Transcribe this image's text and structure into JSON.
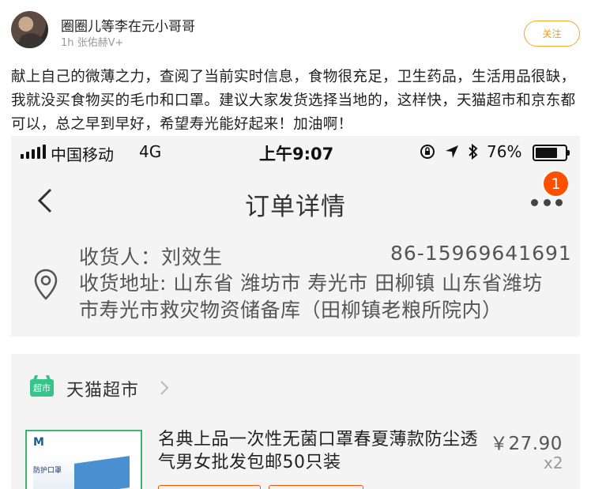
{
  "post": {
    "username": "圈圈儿等李在元小哥哥",
    "meta": "1h 张佑赫V+",
    "follow_label": "关注",
    "text": "献上自己的微薄之力，查阅了当前实时信息，食物很充足，卫生药品，生活用品很缺，我就没买食物买的毛巾和口罩。建议大家发货选择当地的，这样快，天猫超市和京东都可以，总之早到早好，希望寿光能好起来！加油啊！"
  },
  "screenshot": {
    "status_bar": {
      "carrier": "中国移动",
      "network": "4G",
      "time": "上午9:07",
      "battery_text": "76%",
      "battery_level": 0.76
    },
    "nav": {
      "title": "订单详情",
      "badge_count": "1"
    },
    "address": {
      "recipient_label": "收货人：刘效生",
      "phone": "86-15969641691",
      "address_text": "收货地址: 山东省 潍坊市 寿光市 田柳镇 山东省潍坊市寿光市救灾物资储备库（田柳镇老粮所院内）"
    },
    "store": {
      "logo_text": "超市",
      "name": "天猫超市"
    },
    "product": {
      "title": "名典上品一次性无菌口罩春夏薄款防尘透气男女批发包邮50只装",
      "price": "￥27.90",
      "quantity": "x2",
      "thumb_logo": "M",
      "thumb_text": "防护口罩"
    },
    "colors": {
      "accent": "#ff5000",
      "follow": "#f39c12",
      "tmall_green": "#36c48a"
    }
  }
}
